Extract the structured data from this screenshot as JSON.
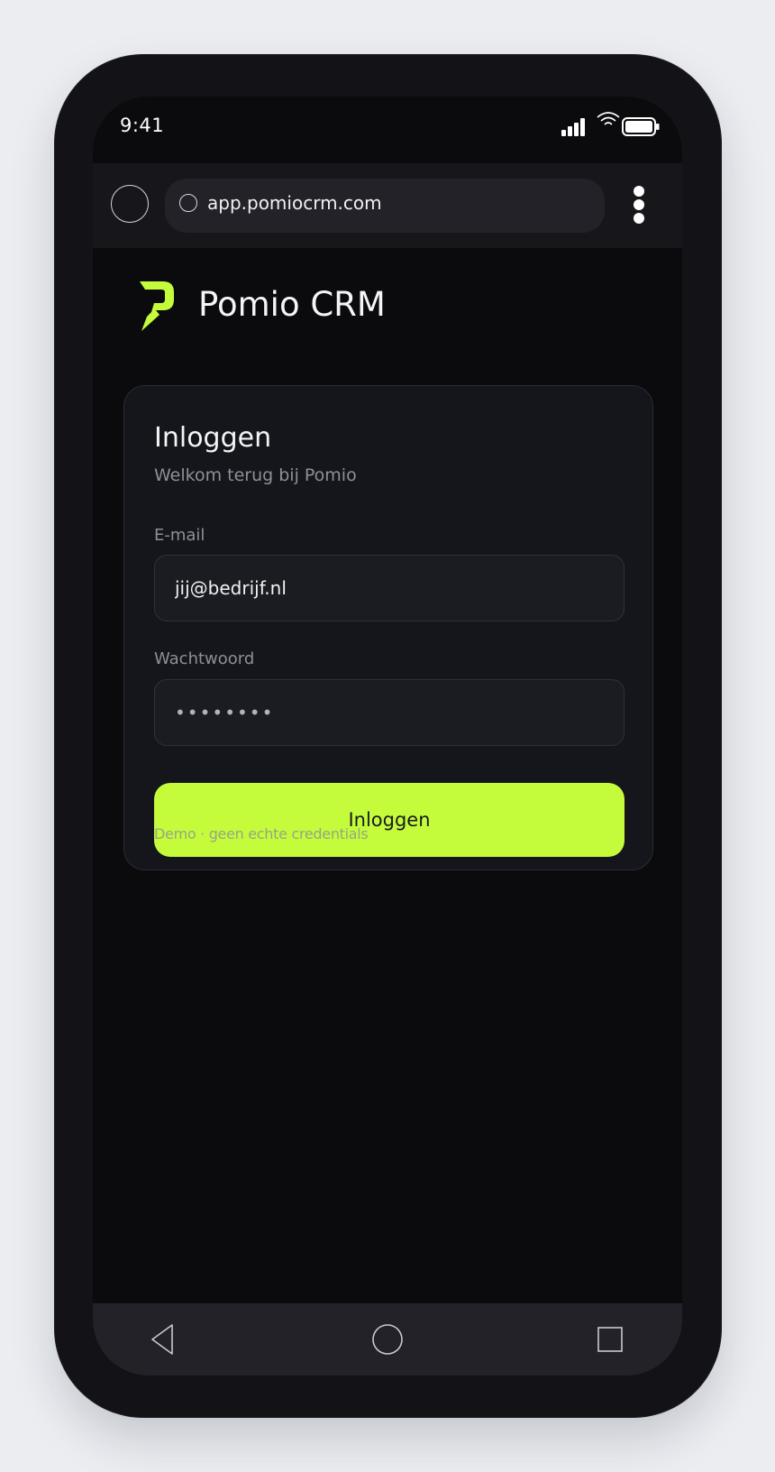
{
  "status_bar": {
    "time": "9:41",
    "icons": [
      "signal-icon",
      "wifi-icon",
      "battery-icon"
    ]
  },
  "browser": {
    "url": "app.pomiocrm.com",
    "menu_icon": "more-vertical-icon"
  },
  "brand": {
    "name": "Pomio CRM",
    "logo_icon": "pomio-logo-icon",
    "accent_color": "#c4fc3c"
  },
  "login": {
    "title": "Inloggen",
    "subtitle": "Welkom terug bij Pomio",
    "email_label": "E-mail",
    "email_value": "jij@bedrijf.nl",
    "password_label": "Wachtwoord",
    "password_value": "••••••••",
    "submit_label": "Inloggen",
    "demo_note": "Demo · geen echte credentials"
  },
  "nav_bar": {
    "icons": [
      "back-icon",
      "home-icon",
      "recents-icon"
    ]
  }
}
